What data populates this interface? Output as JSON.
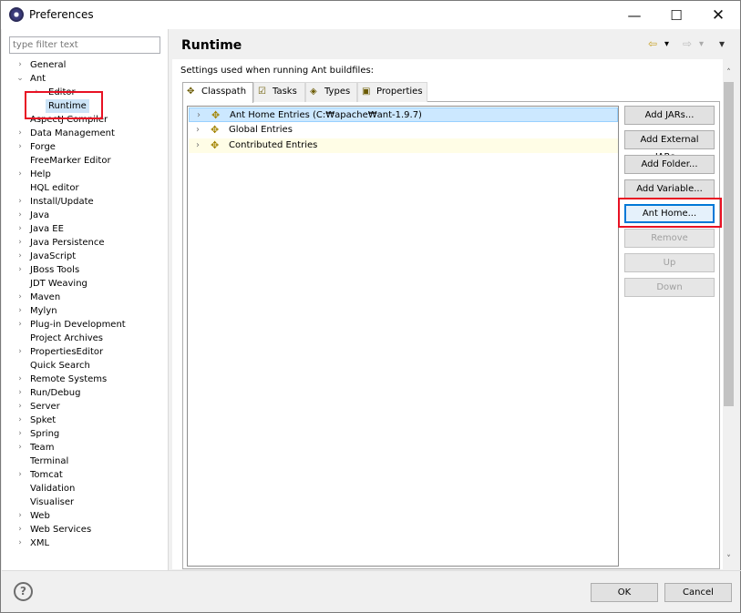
{
  "window": {
    "title": "Preferences",
    "minimize_glyph": "—",
    "maximize_glyph": "☐",
    "close_glyph": "✕"
  },
  "sidebar": {
    "filter_placeholder": "type filter text",
    "items": [
      {
        "label": "General",
        "expander": "›"
      },
      {
        "label": "Ant",
        "expander": "⌄"
      },
      {
        "label": "Editor",
        "expander": "›"
      },
      {
        "label": "Runtime",
        "expander": ""
      },
      {
        "label": "AspectJ Compiler",
        "expander": ""
      },
      {
        "label": "Data Management",
        "expander": "›"
      },
      {
        "label": "Forge",
        "expander": "›"
      },
      {
        "label": "FreeMarker Editor",
        "expander": ""
      },
      {
        "label": "Help",
        "expander": "›"
      },
      {
        "label": "HQL editor",
        "expander": ""
      },
      {
        "label": "Install/Update",
        "expander": "›"
      },
      {
        "label": "Java",
        "expander": "›"
      },
      {
        "label": "Java EE",
        "expander": "›"
      },
      {
        "label": "Java Persistence",
        "expander": "›"
      },
      {
        "label": "JavaScript",
        "expander": "›"
      },
      {
        "label": "JBoss Tools",
        "expander": "›"
      },
      {
        "label": "JDT Weaving",
        "expander": ""
      },
      {
        "label": "Maven",
        "expander": "›"
      },
      {
        "label": "Mylyn",
        "expander": "›"
      },
      {
        "label": "Plug-in Development",
        "expander": "›"
      },
      {
        "label": "Project Archives",
        "expander": ""
      },
      {
        "label": "PropertiesEditor",
        "expander": "›"
      },
      {
        "label": "Quick Search",
        "expander": ""
      },
      {
        "label": "Remote Systems",
        "expander": "›"
      },
      {
        "label": "Run/Debug",
        "expander": "›"
      },
      {
        "label": "Server",
        "expander": "›"
      },
      {
        "label": "Spket",
        "expander": "›"
      },
      {
        "label": "Spring",
        "expander": "›"
      },
      {
        "label": "Team",
        "expander": "›"
      },
      {
        "label": "Terminal",
        "expander": ""
      },
      {
        "label": "Tomcat",
        "expander": "›"
      },
      {
        "label": "Validation",
        "expander": ""
      },
      {
        "label": "Visualiser",
        "expander": ""
      },
      {
        "label": "Web",
        "expander": "›"
      },
      {
        "label": "Web Services",
        "expander": "›"
      },
      {
        "label": "XML",
        "expander": "›"
      }
    ]
  },
  "main": {
    "title": "Runtime",
    "nav": {
      "back_glyph": "⇦",
      "back_menu_glyph": "▾",
      "forward_glyph": "⇨",
      "forward_menu_glyph": "▾",
      "view_menu_glyph": "▾"
    },
    "description": "Settings used when running Ant buildfiles:",
    "tabs": [
      {
        "label": "Classpath",
        "icon": "classpath-icon",
        "glyph": "✥"
      },
      {
        "label": "Tasks",
        "icon": "tasks-icon",
        "glyph": "☑"
      },
      {
        "label": "Types",
        "icon": "types-icon",
        "glyph": "◈"
      },
      {
        "label": "Properties",
        "icon": "properties-icon",
        "glyph": "▣"
      }
    ],
    "entries": [
      {
        "label": "Ant Home Entries (C:₩apache₩ant-1.9.7)",
        "chevron": "›",
        "icon_glyph": "✥"
      },
      {
        "label": "Global Entries",
        "chevron": "›",
        "icon_glyph": "✥"
      },
      {
        "label": "Contributed Entries",
        "chevron": "›",
        "icon_glyph": "✥"
      }
    ],
    "buttons": [
      {
        "label": "Add JARs...",
        "enabled": true
      },
      {
        "label": "Add External JARs...",
        "enabled": true
      },
      {
        "label": "Add Folder...",
        "enabled": true
      },
      {
        "label": "Add Variable...",
        "enabled": true
      },
      {
        "label": "Ant Home...",
        "enabled": true
      },
      {
        "label": "Remove",
        "enabled": false
      },
      {
        "label": "Up",
        "enabled": false
      },
      {
        "label": "Down",
        "enabled": false
      }
    ],
    "scroll_up_glyph": "˄",
    "scroll_down_glyph": "˅"
  },
  "footer": {
    "help_glyph": "?",
    "ok_label": "OK",
    "cancel_label": "Cancel"
  },
  "colors": {
    "selection": "#cce4f7",
    "highlight_box": "#e81123",
    "focus_border": "#0078d7"
  }
}
